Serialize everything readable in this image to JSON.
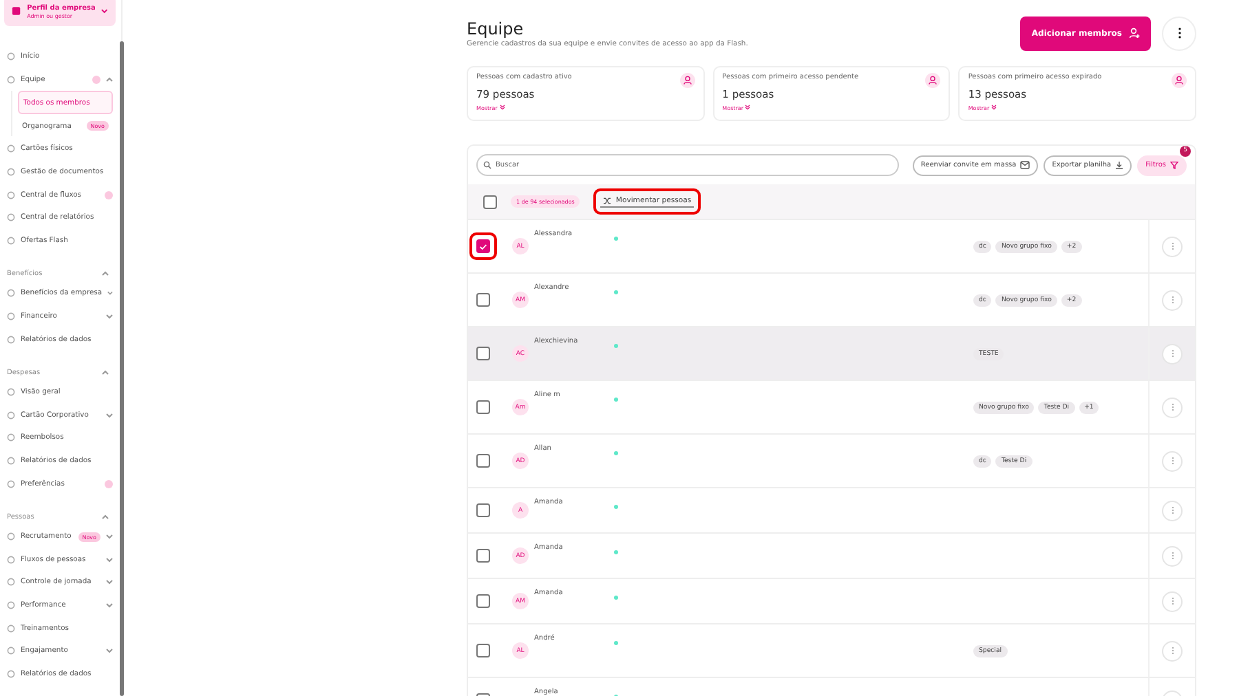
{
  "sidebar": {
    "profile": {
      "name": "Perfil da empresa",
      "role": "Admin ou gestor"
    },
    "groups": [
      {
        "items": [
          {
            "label": "Início",
            "dot": false,
            "selected": false
          },
          {
            "label": "Equipe",
            "dot": true,
            "expanded": true,
            "selected": false,
            "children": [
              {
                "label": "Todos os membros",
                "selected": true
              },
              {
                "label": "Organograma",
                "badge": "Novo",
                "selected": false
              }
            ]
          },
          {
            "label": "Cartões físicos",
            "dot": false,
            "selected": false
          },
          {
            "label": "Gestão de documentos",
            "dot": false,
            "selected": false
          },
          {
            "label": "Central de fluxos",
            "dot": true,
            "selected": false
          },
          {
            "label": "Central de relatórios",
            "dot": false,
            "selected": false
          },
          {
            "label": "Ofertas Flash",
            "dot": false,
            "selected": false
          }
        ]
      },
      {
        "title": "Benefícios",
        "expanded": true,
        "items": [
          {
            "label": "Benefícios da empresa",
            "dot": false,
            "expanded": false,
            "selected": false
          },
          {
            "label": "Financeiro",
            "dot": false,
            "expanded": false,
            "selected": false
          },
          {
            "label": "Relatórios de dados",
            "dot": false,
            "selected": false
          }
        ]
      },
      {
        "title": "Despesas",
        "expanded": true,
        "items": [
          {
            "label": "Visão geral",
            "dot": false,
            "selected": false
          },
          {
            "label": "Cartão Corporativo",
            "dot": false,
            "expanded": false,
            "selected": false
          },
          {
            "label": "Reembolsos",
            "dot": false,
            "selected": false
          },
          {
            "label": "Relatórios de dados",
            "dot": false,
            "selected": false
          },
          {
            "label": "Preferências",
            "dot": true,
            "selected": false
          }
        ]
      },
      {
        "title": "Pessoas",
        "expanded": true,
        "items": [
          {
            "label": "Recrutamento",
            "badge": "Novo",
            "dot": false,
            "expanded": false,
            "selected": false
          },
          {
            "label": "Fluxos de pessoas",
            "dot": false,
            "expanded": false,
            "selected": false
          },
          {
            "label": "Controle de jornada",
            "dot": false,
            "expanded": false,
            "selected": false
          },
          {
            "label": "Performance",
            "dot": false,
            "expanded": false,
            "selected": false
          },
          {
            "label": "Treinamentos",
            "dot": false,
            "selected": false
          },
          {
            "label": "Engajamento",
            "dot": false,
            "expanded": false,
            "selected": false
          },
          {
            "label": "Relatórios de dados",
            "dot": false,
            "selected": false
          }
        ]
      }
    ]
  },
  "header": {
    "title": "Equipe",
    "subtitle": "Gerencie cadastros da sua equipe e envie convites de acesso ao app da Flash.",
    "add_button": "Adicionar membros"
  },
  "stats": [
    {
      "label": "Pessoas com cadastro ativo",
      "value": "79 pessoas",
      "link": "Mostrar"
    },
    {
      "label": "Pessoas com primeiro acesso pendente",
      "value": "1 pessoas",
      "link": "Mostrar"
    },
    {
      "label": "Pessoas com primeiro acesso expirado",
      "value": "13 pessoas",
      "link": "Mostrar"
    }
  ],
  "toolbar": {
    "search": {
      "placeholder": "Buscar"
    },
    "resend_button": "Reenviar convite em massa",
    "export_button": "Exportar planilha",
    "filter_button": "Filtros",
    "filter_count": "5"
  },
  "selection": {
    "all_checked": false,
    "count": "1 de 94 selecionados",
    "move_button": "Movimentar pessoas",
    "move_highlighted": true
  },
  "rows": [
    {
      "initials": "AL",
      "name": "Alessandra",
      "checked": true,
      "highlighted": true,
      "hovered": false,
      "tags": [
        "dc",
        "Novo grupo fixo",
        "+2"
      ]
    },
    {
      "initials": "AM",
      "name": "Alexandre",
      "checked": false,
      "highlighted": false,
      "hovered": false,
      "tags": [
        "dc",
        "Novo grupo fixo",
        "+2"
      ]
    },
    {
      "initials": "AC",
      "name": "Alexchievina",
      "checked": false,
      "highlighted": false,
      "hovered": true,
      "tags": [
        "TESTE"
      ]
    },
    {
      "initials": "Am",
      "name": "Aline m",
      "checked": false,
      "highlighted": false,
      "hovered": false,
      "tags": [
        "Novo grupo fixo",
        "Teste Di",
        "+1"
      ]
    },
    {
      "initials": "AD",
      "name": "Allan",
      "checked": false,
      "highlighted": false,
      "hovered": false,
      "tags": [
        "dc",
        "Teste Di"
      ]
    },
    {
      "initials": "A",
      "name": "Amanda",
      "checked": false,
      "highlighted": false,
      "hovered": false,
      "tags": []
    },
    {
      "initials": "AD",
      "name": "Amanda",
      "checked": false,
      "highlighted": false,
      "hovered": false,
      "tags": []
    },
    {
      "initials": "AM",
      "name": "Amanda",
      "checked": false,
      "highlighted": false,
      "hovered": false,
      "tags": []
    },
    {
      "initials": "AL",
      "name": "André",
      "checked": false,
      "highlighted": false,
      "hovered": false,
      "tags": [
        "Special"
      ]
    },
    {
      "name": "Angela",
      "checked": false,
      "highlighted": false,
      "hovered": false,
      "tags": []
    }
  ]
}
